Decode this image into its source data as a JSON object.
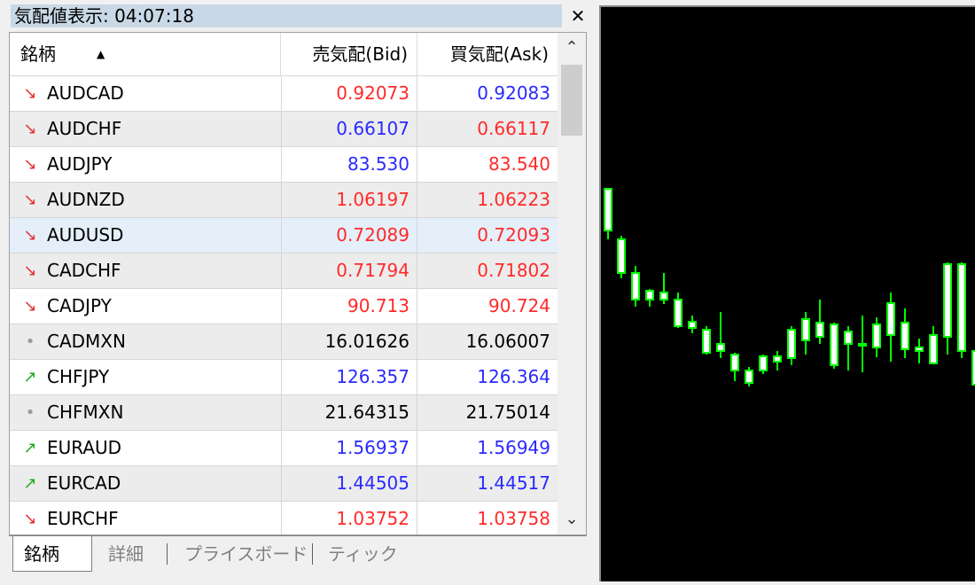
{
  "window": {
    "title": "気配値表示: 04:07:18"
  },
  "icons": {
    "close": "close-icon",
    "sort": "sort-ascending-icon",
    "scroll_up": "chevron-up-icon",
    "scroll_down": "chevron-down-icon"
  },
  "colors": {
    "up": "#1faa1f",
    "down": "#e63030",
    "neutral": "#9a9a9a",
    "bid_ask_up": "#2a2aff",
    "bid_ask_down": "#ff2a2a",
    "bid_ask_neutral": "#000000",
    "candle": "#00ff00"
  },
  "table": {
    "headers": {
      "symbol": "銘柄",
      "bid": "売気配(Bid)",
      "ask": "買気配(Ask)"
    },
    "rows": [
      {
        "dir": "down",
        "icon": "↘",
        "symbol": "AUDCAD",
        "bid": "0.92073",
        "ask": "0.92083",
        "bid_color": "red",
        "ask_color": "blue"
      },
      {
        "dir": "down",
        "icon": "↘",
        "symbol": "AUDCHF",
        "bid": "0.66107",
        "ask": "0.66117",
        "bid_color": "blue",
        "ask_color": "red"
      },
      {
        "dir": "down",
        "icon": "↘",
        "symbol": "AUDJPY",
        "bid": "83.530",
        "ask": "83.540",
        "bid_color": "blue",
        "ask_color": "red"
      },
      {
        "dir": "down",
        "icon": "↘",
        "symbol": "AUDNZD",
        "bid": "1.06197",
        "ask": "1.06223",
        "bid_color": "red",
        "ask_color": "red"
      },
      {
        "dir": "down",
        "icon": "↘",
        "symbol": "AUDUSD",
        "bid": "0.72089",
        "ask": "0.72093",
        "bid_color": "red",
        "ask_color": "red",
        "selected": true
      },
      {
        "dir": "down",
        "icon": "↘",
        "symbol": "CADCHF",
        "bid": "0.71794",
        "ask": "0.71802",
        "bid_color": "red",
        "ask_color": "red"
      },
      {
        "dir": "down",
        "icon": "↘",
        "symbol": "CADJPY",
        "bid": "90.713",
        "ask": "90.724",
        "bid_color": "red",
        "ask_color": "red"
      },
      {
        "dir": "neutral",
        "icon": "•",
        "symbol": "CADMXN",
        "bid": "16.01626",
        "ask": "16.06007",
        "bid_color": "black",
        "ask_color": "black"
      },
      {
        "dir": "up",
        "icon": "↗",
        "symbol": "CHFJPY",
        "bid": "126.357",
        "ask": "126.364",
        "bid_color": "blue",
        "ask_color": "blue"
      },
      {
        "dir": "neutral",
        "icon": "•",
        "symbol": "CHFMXN",
        "bid": "21.64315",
        "ask": "21.75014",
        "bid_color": "black",
        "ask_color": "black"
      },
      {
        "dir": "up",
        "icon": "↗",
        "symbol": "EURAUD",
        "bid": "1.56937",
        "ask": "1.56949",
        "bid_color": "blue",
        "ask_color": "blue"
      },
      {
        "dir": "up",
        "icon": "↗",
        "symbol": "EURCAD",
        "bid": "1.44505",
        "ask": "1.44517",
        "bid_color": "blue",
        "ask_color": "blue"
      },
      {
        "dir": "down",
        "icon": "↘",
        "symbol": "EURCHF",
        "bid": "1.03752",
        "ask": "1.03758",
        "bid_color": "red",
        "ask_color": "red"
      }
    ]
  },
  "tabs": [
    {
      "label": "銘柄",
      "active": true
    },
    {
      "label": "詳細",
      "active": false
    },
    {
      "label": "プライスボード",
      "active": false
    },
    {
      "label": "ティック",
      "active": false
    }
  ]
}
